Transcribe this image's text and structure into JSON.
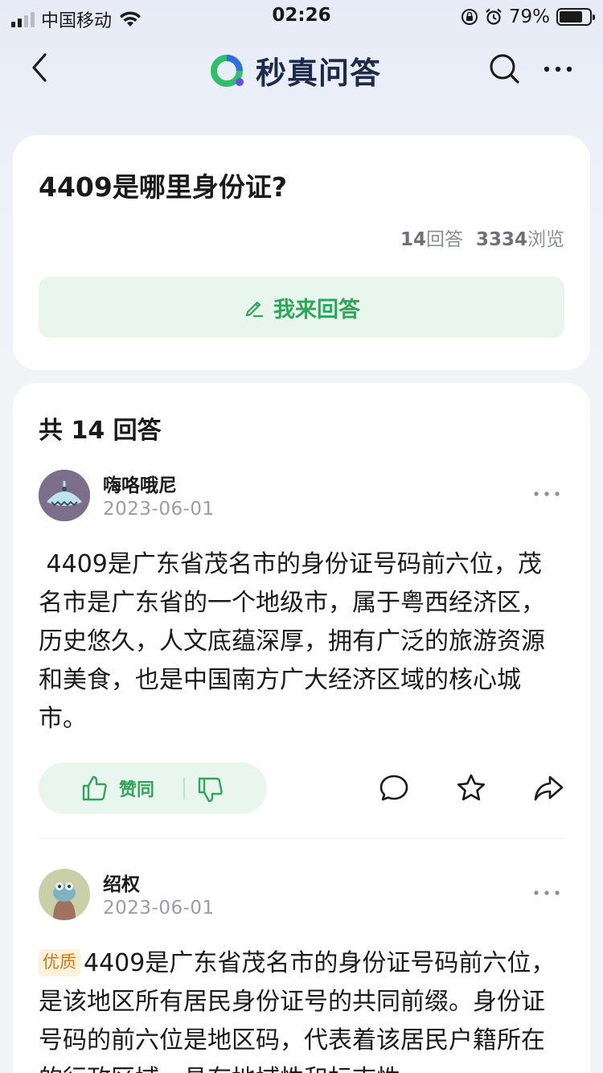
{
  "status_bar": {
    "carrier": "中国移动",
    "time": "02:26",
    "battery_percent": "79%",
    "battery_level": 0.79
  },
  "nav": {
    "brand_name": "秒真问答",
    "back_icon": "chevron-left-icon",
    "search_icon": "search-icon",
    "more_icon": "more-horizontal-icon"
  },
  "question": {
    "title": "4409是哪里身份证?",
    "answers_count": "14",
    "answers_label": "回答",
    "views_count": "3334",
    "views_label": "浏览",
    "answer_button_label": "我来回答"
  },
  "answers_section": {
    "prefix": "共",
    "count": "14",
    "suffix": "回答"
  },
  "answers": [
    {
      "author": "嗨咯哦尼",
      "date": "2023-06-01",
      "badge": "",
      "body": " 4409是广东省茂名市的身份证号码前六位，茂名市是广东省的一个地级市，属于粤西经济区，历史悠久，人文底蕴深厚，拥有广泛的旅游资源和美食，也是中国南方广大经济区域的核心城市。",
      "like_label": "赞同"
    },
    {
      "author": "绍权",
      "date": "2023-06-01",
      "badge": "优质",
      "body": "4409是广东省茂名市的身份证号码前六位，是该地区所有居民身份证号的共同前缀。身份证号码的前六位是地区码，代表着该居民户籍所在的行政区域，具有地域性和标志性。"
    }
  ],
  "colors": {
    "accent_green": "#2fa65a",
    "accent_green_bg": "#e8f6ee",
    "badge_bg": "#fdf1dc",
    "badge_text": "#c6791f",
    "brand_text": "#1d2a4a"
  }
}
